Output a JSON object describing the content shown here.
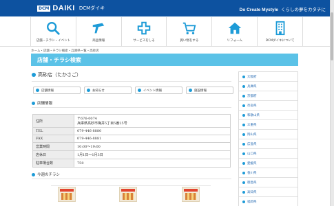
{
  "header": {
    "logo_box": "DCM",
    "logo_text": "DAIKI",
    "logo_sub": "DCMダイキ",
    "tagline_bold": "Do Create Mystyle",
    "tagline": "くらしの夢をカタチに"
  },
  "nav": [
    {
      "label": "店舗・チラシ・イベント",
      "icon": "search-icon"
    },
    {
      "label": "商品情報",
      "icon": "tool-icon"
    },
    {
      "label": "サービスをしる",
      "icon": "cross-icon"
    },
    {
      "label": "買い物をする",
      "icon": "cart-icon"
    },
    {
      "label": "リフォーム",
      "icon": "house-icon"
    },
    {
      "label": "DCMダイキについて",
      "icon": "building-icon"
    }
  ],
  "breadcrumb": "ホーム・店舗・チラシ検索・兵庫県一覧・高砂店",
  "page_title": "店舗・チラシ検索",
  "store": {
    "name": "高砂店（たかさご）",
    "buttons": [
      "店舗情報",
      "お知らせ",
      "イベント情報",
      "施設情報"
    ],
    "info_heading": "店舗情報",
    "table": [
      {
        "key": "住所",
        "value_line1": "〒676-0074",
        "value_line2": "兵庫県高砂市梅井5丁目5番25号"
      },
      {
        "key": "TEL",
        "value": "079-446-8880"
      },
      {
        "key": "FAX",
        "value": "079-446-8881"
      },
      {
        "key": "営業時間",
        "value": "10:00〜19:00"
      },
      {
        "key": "店休日",
        "value": "1月1日〜1月3日"
      },
      {
        "key": "駐車場台数",
        "value": "750"
      }
    ],
    "flyer_heading": "今週のチラシ"
  },
  "sidebar": [
    "大阪府",
    "兵庫県",
    "京都府",
    "奈良県",
    "和歌山県",
    "三重県",
    "岡山県",
    "広島県",
    "山口県",
    "愛媛県",
    "香川県",
    "徳島県",
    "高知県",
    "福岡県"
  ],
  "colors": {
    "brand": "#0d52a0",
    "accent": "#5bc2e7",
    "dot": "#1d9bd7"
  }
}
